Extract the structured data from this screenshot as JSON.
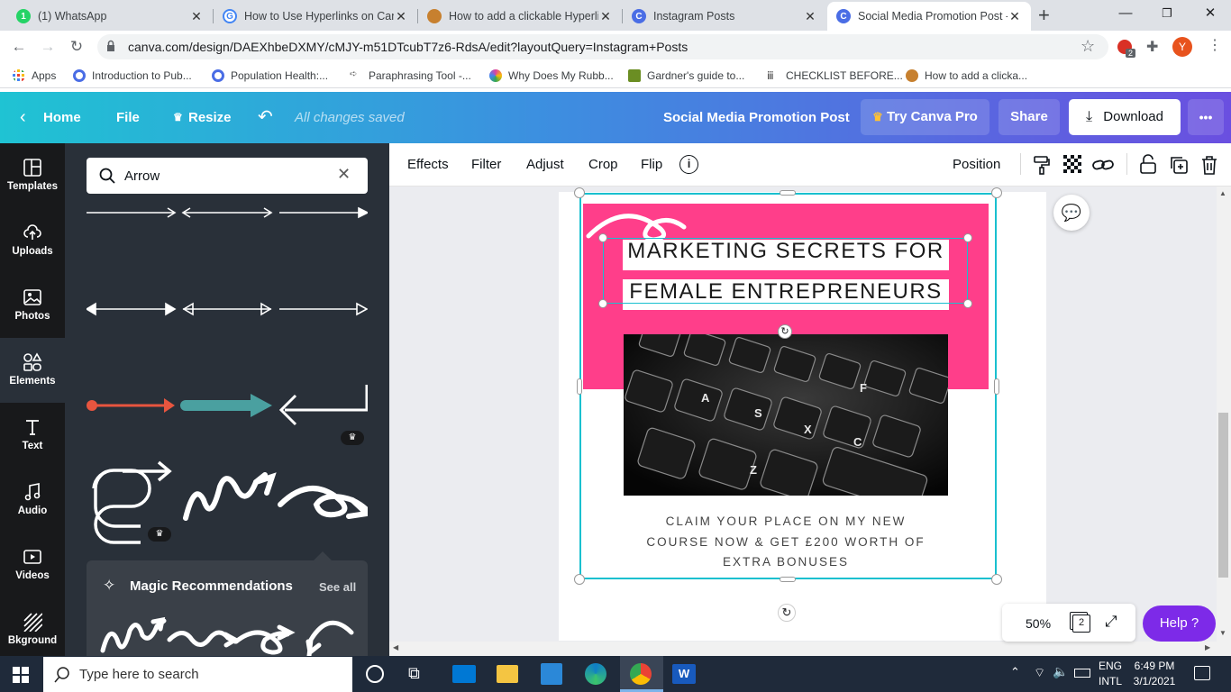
{
  "browser": {
    "tabs": [
      {
        "title": "(1) WhatsApp",
        "favicon_color": "#25d366"
      },
      {
        "title": "How to Use Hyperlinks on Can",
        "favicon_color": "#4285f4"
      },
      {
        "title": "How to add a clickable Hyperli",
        "favicon_color": "#c7802f"
      },
      {
        "title": "Instagram Posts",
        "favicon_color": "#4a6de5"
      },
      {
        "title": "Social Media Promotion Post -",
        "favicon_color": "#4a6de5"
      }
    ],
    "url": "canva.com/design/DAEXhbeDXMY/cMJY-m51DTcubT7z6-RdsA/edit?layoutQuery=Instagram+Posts",
    "profile_initial": "Y",
    "extension_badge": "2",
    "bookmarks": [
      {
        "label": "Apps",
        "color": "#ea4335"
      },
      {
        "label": "Introduction to Pub...",
        "color": "#4a6de5"
      },
      {
        "label": "Population Health:...",
        "color": "#4a6de5"
      },
      {
        "label": "Paraphrasing Tool -...",
        "color": "#666666"
      },
      {
        "label": "Why Does My Rubb...",
        "color": "#e040a0"
      },
      {
        "label": "Gardner's guide to...",
        "color": "#6b8e23"
      },
      {
        "label": "CHECKLIST BEFORE...",
        "color": "#333333"
      },
      {
        "label": "How to add a clicka...",
        "color": "#c7802f"
      }
    ]
  },
  "canva_header": {
    "home": "Home",
    "file": "File",
    "resize": "Resize",
    "status": "All changes saved",
    "design_title": "Social Media Promotion Post",
    "try_pro": "Try Canva Pro",
    "share": "Share",
    "download": "Download",
    "more": "•••"
  },
  "sidebar": {
    "items": [
      {
        "label": "Templates"
      },
      {
        "label": "Uploads"
      },
      {
        "label": "Photos"
      },
      {
        "label": "Elements"
      },
      {
        "label": "Text"
      },
      {
        "label": "Audio"
      },
      {
        "label": "Videos"
      },
      {
        "label": "Bkground"
      }
    ]
  },
  "panel": {
    "search_value": "Arrow",
    "magic_title": "Magic Recommendations",
    "see_all": "See all"
  },
  "toolbar": {
    "effects": "Effects",
    "filter": "Filter",
    "adjust": "Adjust",
    "crop": "Crop",
    "flip": "Flip",
    "position": "Position"
  },
  "design": {
    "headline_line1": "MARKETING SECRETS FOR",
    "headline_line2": "FEMALE ENTREPRENEURS",
    "body_line1": "CLAIM YOUR PLACE ON MY NEW",
    "body_line2": "COURSE NOW & GET £200 WORTH OF",
    "body_line3": "EXTRA BONUSES",
    "accent_color": "#ff3e8a"
  },
  "footer": {
    "zoom": "50%",
    "page_count": "2",
    "help": "Help ?"
  },
  "taskbar": {
    "search_placeholder": "Type here to search",
    "lang1": "ENG",
    "lang2": "INTL",
    "time": "6:49 PM",
    "date": "3/1/2021"
  }
}
